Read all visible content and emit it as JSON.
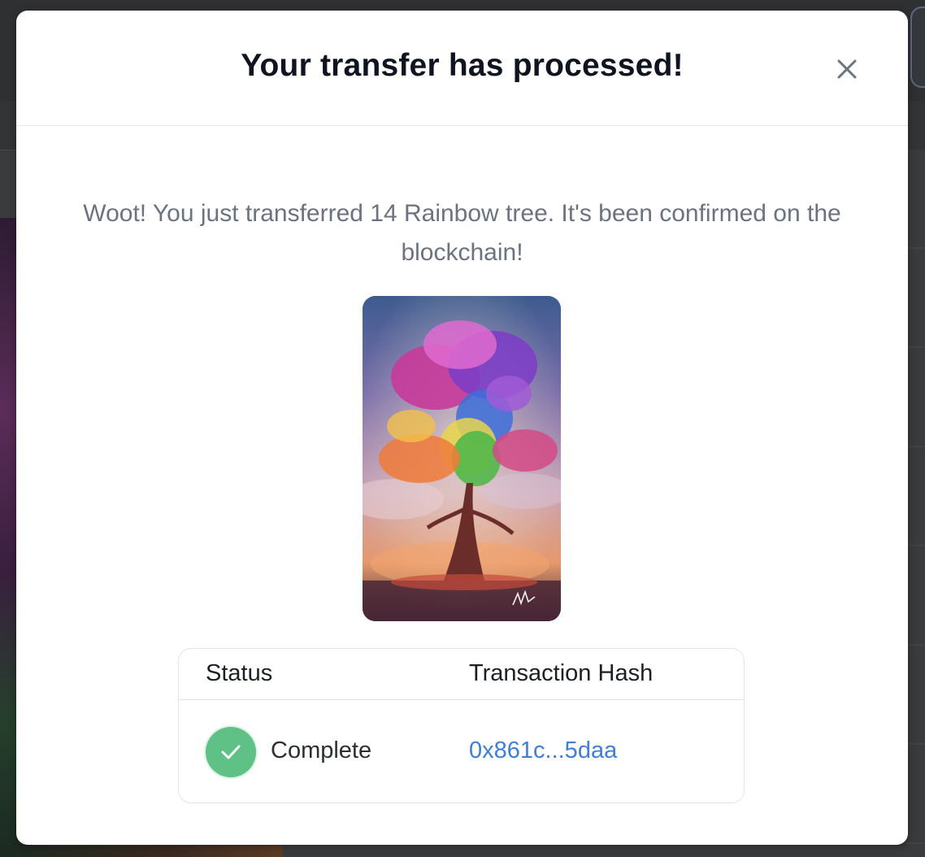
{
  "modal": {
    "title": "Your transfer has processed!",
    "message": "Woot! You just transferred 14 Rainbow tree. It's been confirmed on the blockchain!",
    "close_icon": "close-icon"
  },
  "transaction": {
    "headers": {
      "status": "Status",
      "hash": "Transaction Hash"
    },
    "status_value": "Complete",
    "status_icon": "check-circle-icon",
    "status_color": "#5fc186",
    "hash_value": "0x861c...5daa",
    "link_color": "#3f7fd6"
  }
}
